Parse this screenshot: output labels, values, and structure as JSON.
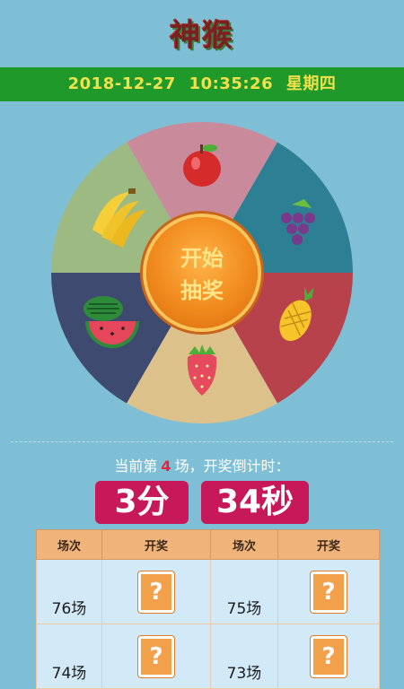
{
  "app": {
    "title": "神猴"
  },
  "datebar": {
    "date": "2018-12-27",
    "time": "10:35:26",
    "weekday": "星期四"
  },
  "wheel": {
    "start_label_1": "开始",
    "start_label_2": "抽奖",
    "segments": [
      {
        "prize": "apple-icon",
        "color": "#c98b9c"
      },
      {
        "prize": "grape-icon",
        "color": "#2d7f93"
      },
      {
        "prize": "pineapple-icon",
        "color": "#b8424b"
      },
      {
        "prize": "strawberry-icon",
        "color": "#ddc18b"
      },
      {
        "prize": "watermelon-icon",
        "color": "#3f4a70"
      },
      {
        "prize": "banana-icon",
        "color": "#9dba83"
      }
    ]
  },
  "status": {
    "prefix": "当前第",
    "round_number": "4",
    "suffix": "场，开奖倒计时："
  },
  "countdown": {
    "minutes": "3分",
    "seconds": "34秒"
  },
  "table": {
    "headers": [
      "场次",
      "开奖",
      "场次",
      "开奖"
    ],
    "rows": [
      {
        "round_a": "76场",
        "result_a": "?",
        "round_b": "75场",
        "result_b": "?"
      },
      {
        "round_a": "74场",
        "result_a": "?",
        "round_b": "73场",
        "result_b": "?"
      }
    ]
  },
  "colors": {
    "background": "#7fbfd5",
    "datebar_bg": "#1f9a2a",
    "datebar_text": "#f2e04a",
    "countdown_bg": "#c7195a",
    "table_header_bg": "#f0b37a",
    "table_cell_bg": "#d2e9f8",
    "accent_red": "#e0263a"
  }
}
